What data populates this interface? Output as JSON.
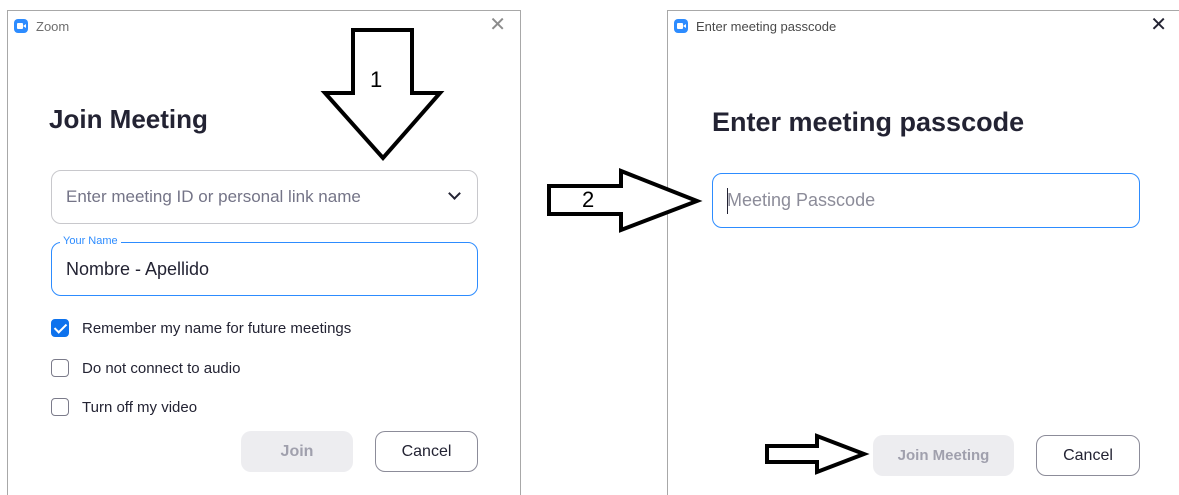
{
  "window1": {
    "title": "Zoom",
    "heading": "Join Meeting",
    "meeting_id_placeholder": "Enter meeting ID or personal link name",
    "name_label": "Your Name",
    "name_value": "Nombre - Apellido",
    "options": [
      {
        "label": "Remember my name for future meetings",
        "checked": true
      },
      {
        "label": "Do not connect to audio",
        "checked": false
      },
      {
        "label": "Turn off my video",
        "checked": false
      }
    ],
    "join_label": "Join",
    "cancel_label": "Cancel"
  },
  "window2": {
    "title": "Enter meeting passcode",
    "heading": "Enter meeting passcode",
    "passcode_placeholder": "Meeting Passcode",
    "join_label": "Join Meeting",
    "cancel_label": "Cancel"
  },
  "annotations": {
    "step1": "1",
    "step2": "2"
  },
  "colors": {
    "accent": "#2d8cff",
    "checkbox": "#0e72ed",
    "disabled_button": "#ededf0"
  }
}
